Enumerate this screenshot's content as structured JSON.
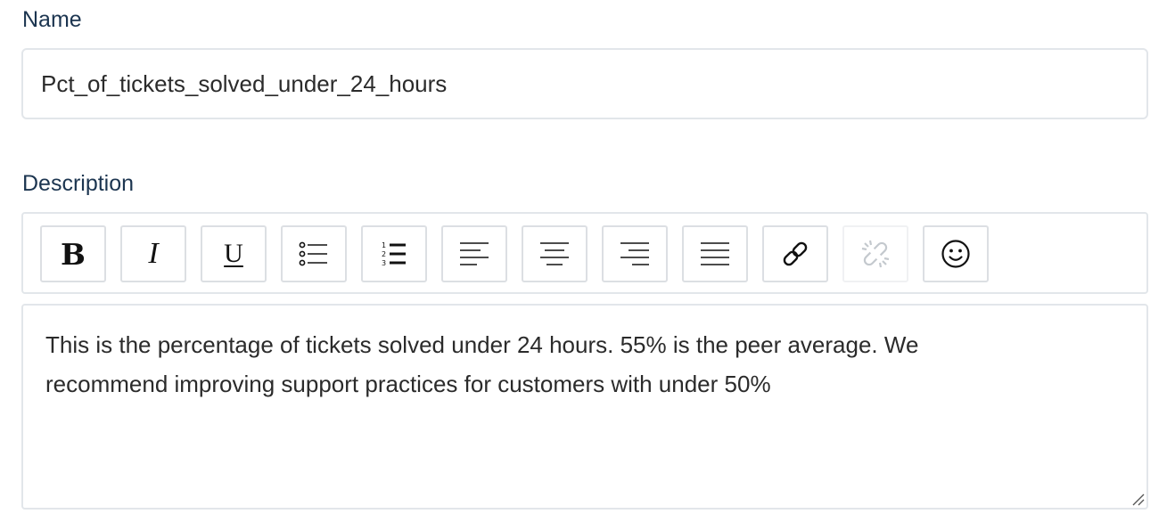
{
  "name_field": {
    "label": "Name",
    "value": "Pct_of_tickets_solved_under_24_hours"
  },
  "description_field": {
    "label": "Description",
    "text": "This is the percentage of tickets solved under 24 hours. 55% is the peer average. We recommend improving support practices for customers with under 50%"
  },
  "toolbar": {
    "bold_glyph": "B",
    "italic_glyph": "I",
    "underline_glyph": "U",
    "buttons": [
      {
        "icon": "bold-icon",
        "enabled": true
      },
      {
        "icon": "italic-icon",
        "enabled": true
      },
      {
        "icon": "underline-icon",
        "enabled": true
      },
      {
        "icon": "bullet-list-icon",
        "enabled": true
      },
      {
        "icon": "numbered-list-icon",
        "enabled": true
      },
      {
        "icon": "align-left-icon",
        "enabled": true
      },
      {
        "icon": "align-center-icon",
        "enabled": true
      },
      {
        "icon": "align-right-icon",
        "enabled": true
      },
      {
        "icon": "align-justify-icon",
        "enabled": true
      },
      {
        "icon": "link-icon",
        "enabled": true
      },
      {
        "icon": "unlink-icon",
        "enabled": false
      },
      {
        "icon": "emoji-icon",
        "enabled": true
      }
    ]
  },
  "colors": {
    "label_text": "#1c3550",
    "body_text": "#2b2b2b",
    "border": "#e2e6ea",
    "disabled_icon": "#c4c9ce"
  }
}
